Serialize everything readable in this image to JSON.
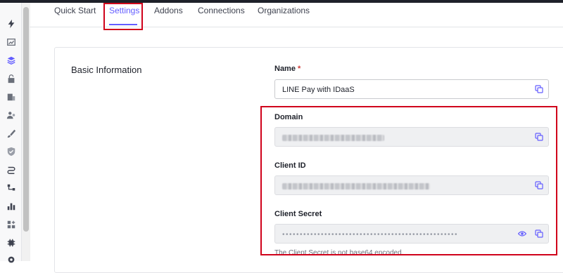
{
  "tabs": [
    {
      "label": "Quick Start"
    },
    {
      "label": "Settings"
    },
    {
      "label": "Addons"
    },
    {
      "label": "Connections"
    },
    {
      "label": "Organizations"
    }
  ],
  "active_tab": "Settings",
  "sidebar_icons": [
    "lightning-icon",
    "chart-icon",
    "layers-icon",
    "lock-icon",
    "building-icon",
    "users-icon",
    "brush-icon",
    "shield-icon",
    "flow-icon",
    "pipeline-icon",
    "bar-chart-icon",
    "extensions-icon",
    "settings-icon",
    "gear-icon"
  ],
  "section": {
    "title": "Basic Information"
  },
  "fields": {
    "name": {
      "label": "Name",
      "required_mark": "*",
      "value": "LINE Pay with IDaaS"
    },
    "domain": {
      "label": "Domain"
    },
    "client_id": {
      "label": "Client ID"
    },
    "client_secret": {
      "label": "Client Secret",
      "masked_value": "••••••••••••••••••••••••••••••••••••••••••••••••••",
      "hint": "The Client Secret is not base64 encoded."
    }
  },
  "colors": {
    "accent": "#635dff",
    "highlight": "#d0021b"
  }
}
